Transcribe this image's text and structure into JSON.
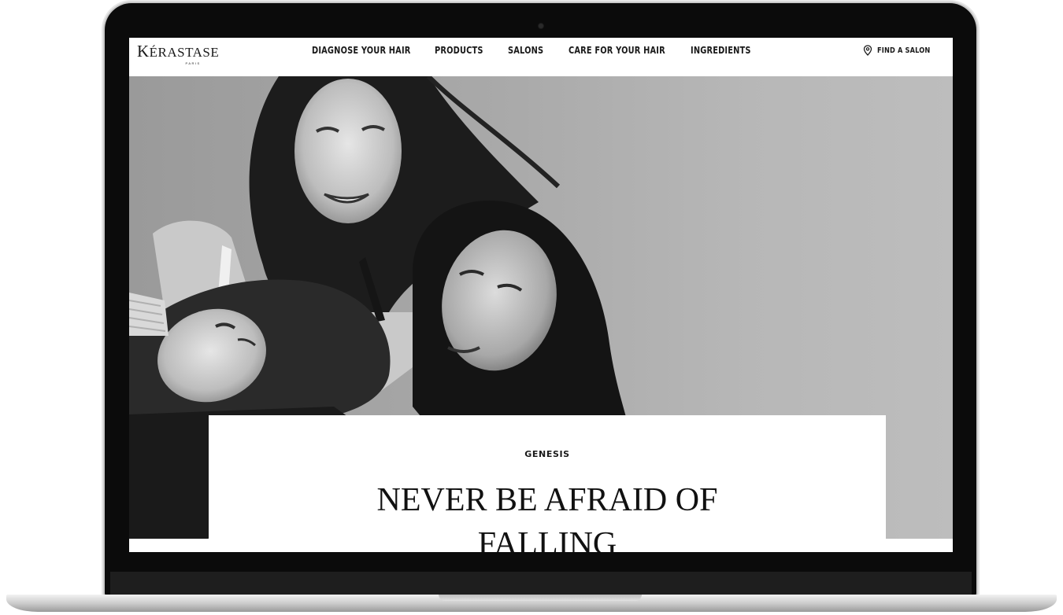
{
  "brand": {
    "name_initial": "K",
    "name_rest": "ÉRASTASE",
    "sub": "PARIS"
  },
  "nav": {
    "items": [
      {
        "label": "DIAGNOSE YOUR HAIR"
      },
      {
        "label": "PRODUCTS"
      },
      {
        "label": "SALONS"
      },
      {
        "label": "CARE FOR YOUR HAIR"
      },
      {
        "label": "INGREDIENTS"
      }
    ],
    "find_salon": {
      "label": "FIND A SALON",
      "icon": "location-pin-icon"
    }
  },
  "hero": {
    "image": "black-and-white photo of three women with dark hair",
    "eyebrow": "GENESIS",
    "headline_line1": "NEVER BE AFRAID OF",
    "headline_line2": "FALLING"
  },
  "colors": {
    "text": "#1a1a1a",
    "hero_background": "#a9a9a9",
    "bezel": "#0b0b0b"
  }
}
